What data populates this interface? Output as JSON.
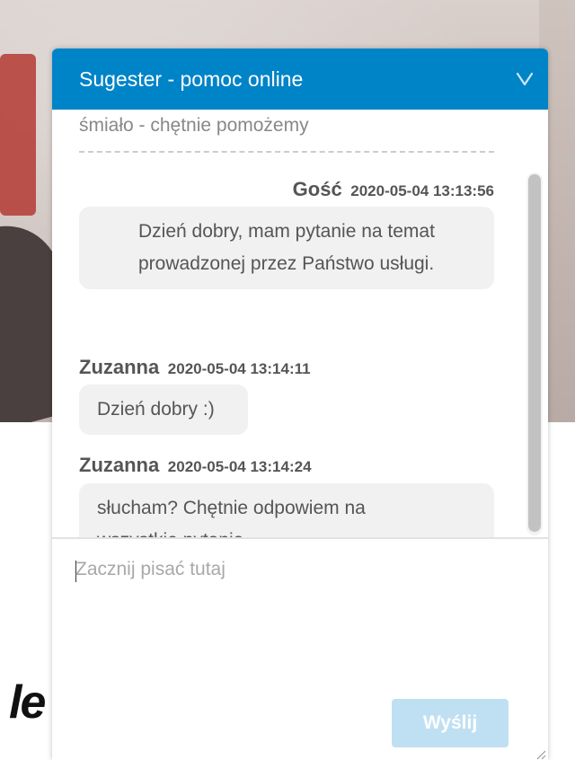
{
  "background": {
    "logo_text": "le"
  },
  "widget": {
    "title": "Sugester - pomoc online",
    "collapse_icon": "chevron-down-icon",
    "accent_color": "#0084c8",
    "intro_text": "śmiało - chętnie pomożemy",
    "messages": [
      {
        "author": "Gość",
        "time": "2020-05-04 13:13:56",
        "text_lines": [
          "Dzień dobry, mam pytanie na temat",
          "prowadzonej przez Państwo usługi."
        ],
        "align": "right"
      },
      {
        "author": "Zuzanna",
        "time": "2020-05-04 13:14:11",
        "text_lines": [
          "Dzień dobry :)"
        ],
        "align": "left"
      },
      {
        "author": "Zuzanna",
        "time": "2020-05-04 13:14:24",
        "text_lines": [
          "słucham? Chętnie odpowiem na",
          "wszystkie pytania"
        ],
        "align": "left"
      }
    ],
    "input": {
      "placeholder": "Zacznij pisać tutaj",
      "value": ""
    },
    "send_label": "Wyślij"
  }
}
